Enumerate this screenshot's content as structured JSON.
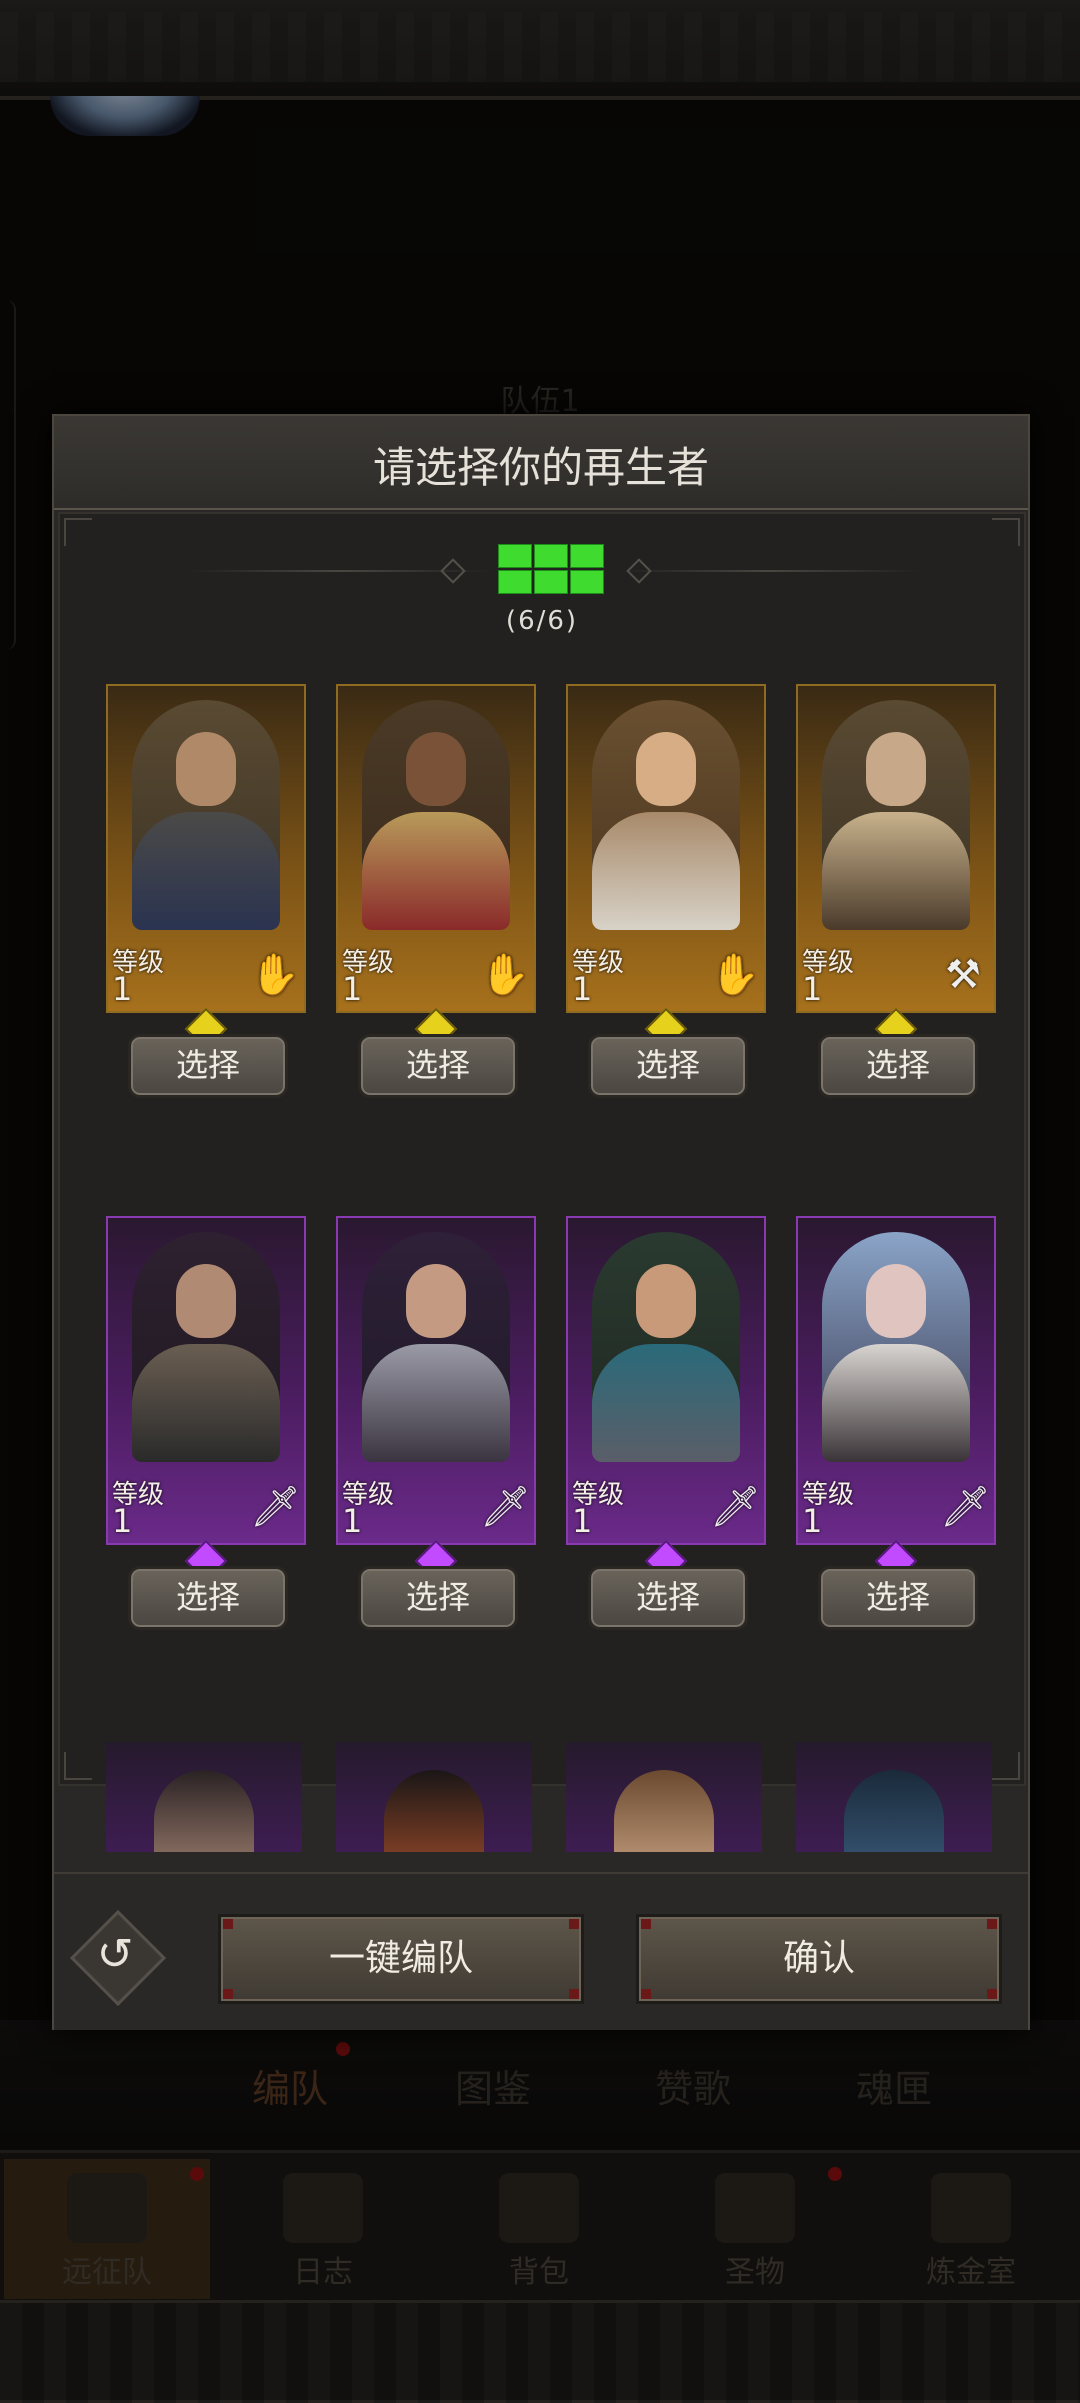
{
  "background": {
    "team_label": "队伍1",
    "tabs": [
      {
        "label": "编队",
        "active": true,
        "badge": true
      },
      {
        "label": "图鉴",
        "active": false,
        "badge": false
      },
      {
        "label": "赞歌",
        "active": false,
        "badge": false
      },
      {
        "label": "魂匣",
        "active": false,
        "badge": false
      }
    ],
    "bottom_nav": [
      {
        "label": "远征队",
        "icon": "helmet-icon",
        "active": true,
        "badge": true
      },
      {
        "label": "日志",
        "icon": "scroll-icon",
        "active": false,
        "badge": false
      },
      {
        "label": "背包",
        "icon": "bag-icon",
        "active": false,
        "badge": false
      },
      {
        "label": "圣物",
        "icon": "relic-icon",
        "active": false,
        "badge": true
      },
      {
        "label": "炼金室",
        "icon": "alchemy-icon",
        "active": false,
        "badge": false
      }
    ]
  },
  "dialog": {
    "title": "请选择你的再生者",
    "team_count": "(6/6)",
    "level_label": "等级",
    "select_label": "选择",
    "heroes": [
      {
        "rarity": "gold",
        "level": "1",
        "class_icon": "hand-icon"
      },
      {
        "rarity": "gold",
        "level": "1",
        "class_icon": "hand-icon"
      },
      {
        "rarity": "gold",
        "level": "1",
        "class_icon": "hand-icon"
      },
      {
        "rarity": "gold",
        "level": "1",
        "class_icon": "shovel-icon"
      },
      {
        "rarity": "purple",
        "level": "1",
        "class_icon": "sword-icon"
      },
      {
        "rarity": "purple",
        "level": "1",
        "class_icon": "sword-icon"
      },
      {
        "rarity": "purple",
        "level": "1",
        "class_icon": "sword-icon"
      },
      {
        "rarity": "purple",
        "level": "1",
        "class_icon": "sword-icon"
      }
    ],
    "auto_form_label": "一键编队",
    "confirm_label": "确认"
  },
  "colors": {
    "gold_card": "#a7711c",
    "purple_card": "#6b2a8a",
    "team_green": "#3fdc2f"
  }
}
